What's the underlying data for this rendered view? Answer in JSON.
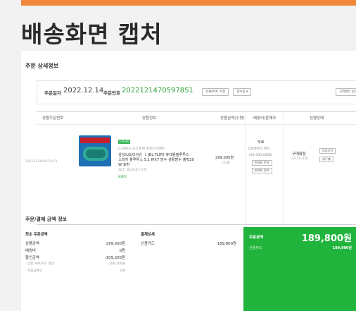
{
  "slide": {
    "title": "배송화면 캡처"
  },
  "order_detail": {
    "section_title": "주문 상세정보",
    "date_label": "주문일자",
    "date": "2022.12.14",
    "number_label": "주문번호",
    "number": "20221214705978S1",
    "buttons": [
      "인쇄/PDF 저장",
      "영수증 ▾"
    ],
    "right_button": "고객센터 문의"
  },
  "items_table": {
    "headers": [
      "상품주문번호",
      "상품정보",
      "상품금액(수량)",
      "배송비/판매자",
      "진행상태"
    ],
    "rows": [
      {
        "item_no": "2022121486978471",
        "badge": "도착보장",
        "seller_note": "(LG에서) 공식 판매 최저가 이벤트",
        "name_lines": [
          "삼성/LG/다이슨 ㅣ JBL FLIP5 휴대용블루투스",
          "스피커 블루투스 5.1 IPX7 방수 생활방수 출력20",
          "W 호환"
        ],
        "option": "색상 : BLACK / 1개",
        "tag": "N페이",
        "price": "299,000원",
        "qty": "(1개)",
        "shipping": "무료",
        "seller_name": "삼성정보사 제이...",
        "seller_phone": "(02-000-0000)",
        "seller_btn1": "판매자 문의",
        "seller_btn2": "판매자 정보",
        "status": "구매확정",
        "status_date": "(12.16 오후)",
        "action1": "리뷰쓰기",
        "action2": "재구매"
      }
    ]
  },
  "payment": {
    "section_title": "주문/결제 금액 정보",
    "left": {
      "head": "최초 주문금액",
      "rows": [
        {
          "label": "상품금액",
          "value": "299,000원"
        },
        {
          "label": "배송비",
          "value": "0원"
        },
        {
          "label": "할인금액",
          "value": "-109,200원"
        },
        {
          "label": "· 상품 쿠폰/카드 할인",
          "value": "-109,200원"
        },
        {
          "label": "· 적립금할인",
          "value": "0원"
        }
      ]
    },
    "middle": {
      "head": "결제상세",
      "method": "신용카드",
      "amount": "189,800원"
    },
    "right": {
      "label": "주문금액",
      "total": "189,800원",
      "method": "신용카드",
      "method_amount": "189,800원"
    }
  },
  "colors": {
    "accent": "#f0893a",
    "green": "#21b43d",
    "link_green": "#2aa134"
  }
}
